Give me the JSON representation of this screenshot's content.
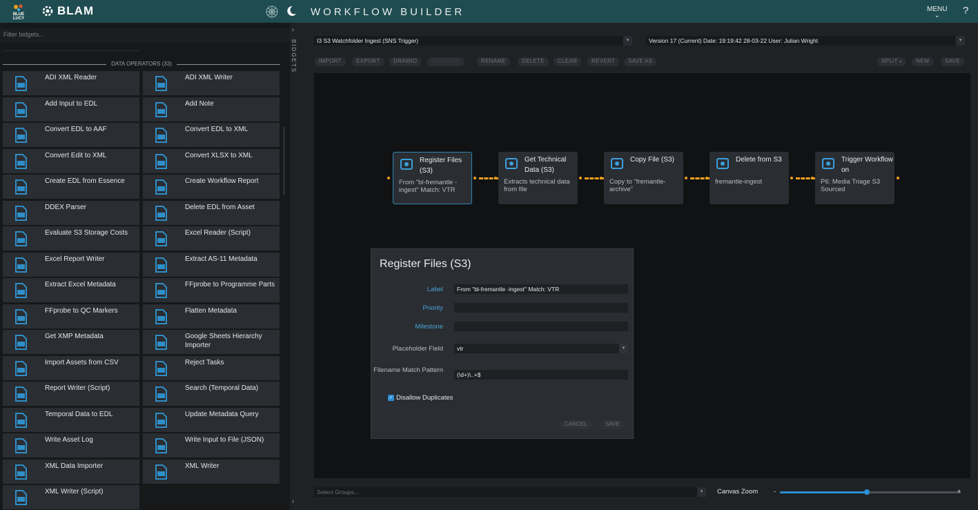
{
  "app": {
    "brand_text": "BLUE LUCY",
    "name": "BLAM",
    "title": "WORKFLOW BUILDER",
    "menu_label": "MENU",
    "help_label": "?",
    "accent_color": "#1f4c50",
    "link_color": "#4aa3d8",
    "connector_color": "#f0a020"
  },
  "sidebar": {
    "filter_placeholder": "Filter bidgets...",
    "section_title": "DATA OPERATORS (33)",
    "tab_label": "BIDGETS",
    "collapse_top_icon": "chevron-right-icon",
    "collapse_bottom_icon": "chevron-left-icon",
    "items": [
      {
        "label": "ADI XML Reader",
        "icon": "xml-file-icon"
      },
      {
        "label": "ADI XML Writer",
        "icon": "xml-file-icon"
      },
      {
        "label": "Add Input to EDL",
        "icon": "edl-add-icon"
      },
      {
        "label": "Add Note",
        "icon": "note-edit-icon"
      },
      {
        "label": "Convert EDL to AAF",
        "icon": "avid-icon"
      },
      {
        "label": "Convert EDL to XML",
        "icon": "edl-xml-icon"
      },
      {
        "label": "Convert Edit to XML",
        "icon": "xml-file-icon"
      },
      {
        "label": "Convert XLSX to XML",
        "icon": "convert-icon"
      },
      {
        "label": "Create EDL from Essence",
        "icon": "edl-download-icon"
      },
      {
        "label": "Create Workflow Report",
        "icon": "excel-icon"
      },
      {
        "label": "DDEX Parser",
        "icon": "ddex-icon"
      },
      {
        "label": "Delete EDL from Asset",
        "icon": "edl-delete-icon"
      },
      {
        "label": "Evaluate S3 Storage Costs",
        "icon": "s3-icon"
      },
      {
        "label": "Excel Reader (Script)",
        "icon": "excel-icon"
      },
      {
        "label": "Excel Report Writer",
        "icon": "pie-chart-icon"
      },
      {
        "label": "Extract AS-11 Metadata",
        "icon": "as11-icon"
      },
      {
        "label": "Extract Excel Metadata",
        "icon": "excel-icon"
      },
      {
        "label": "FFprobe to Programme Parts",
        "icon": "check-circle-icon"
      },
      {
        "label": "FFprobe to QC Markers",
        "icon": "check-circle-icon"
      },
      {
        "label": "Flatten Metadata",
        "icon": "layers-icon"
      },
      {
        "label": "Get XMP Metadata",
        "icon": "file-download-icon"
      },
      {
        "label": "Google Sheets Hierarchy Importer",
        "icon": "google-icon"
      },
      {
        "label": "Import Assets from CSV",
        "icon": "import-icon"
      },
      {
        "label": "Reject Tasks",
        "icon": "bell-icon"
      },
      {
        "label": "Report Writer (Script)",
        "icon": "pie-chart-icon"
      },
      {
        "label": "Search (Temporal Data)",
        "icon": "search-data-icon"
      },
      {
        "label": "Temporal Data to EDL",
        "icon": "edl-icon"
      },
      {
        "label": "Update Metadata Query",
        "icon": "code-icon"
      },
      {
        "label": "Write Asset Log",
        "icon": "pie-chart-icon"
      },
      {
        "label": "Write Input to File (JSON)",
        "icon": "json-file-icon"
      },
      {
        "label": "XML Data Importer",
        "icon": "xml-import-icon"
      },
      {
        "label": "XML Writer",
        "icon": "xml-file-icon"
      },
      {
        "label": "XML Writer (Script)",
        "icon": "xml-edit-icon"
      }
    ]
  },
  "workflow": {
    "selected_workflow": "I3 S3 Watchfolder Ingest (SNS Trigger)",
    "selected_version": "Version 17 (Current) Date: 19:19:42 28-03-22 User: Julian Wright",
    "toolbar": {
      "import": "IMPORT",
      "export": "EXPORT",
      "drawio": "DRAWIO",
      "compare": "COMPARE",
      "rename": "RENAME",
      "delete": "DELETE",
      "clear": "CLEAR",
      "revert": "REVERT",
      "save_as": "SAVE AS",
      "split": "SPLIT",
      "new": "NEW",
      "save": "SAVE"
    },
    "nodes": [
      {
        "title": "Register Files (S3)",
        "desc": "From \"bl-fremantle -ingest\" Match: VTR",
        "icon": "register-files-icon",
        "active": true
      },
      {
        "title": "Get Technical Data (S3)",
        "desc": "Extracts technical data from file",
        "icon": "technical-data-icon",
        "active": false
      },
      {
        "title": "Copy File (S3)",
        "desc": "Copy to \"fremantle-archive\"",
        "icon": "copy-file-icon",
        "active": false
      },
      {
        "title": "Delete from S3",
        "desc": "fremantle-ingest",
        "icon": "delete-s3-icon",
        "active": false
      },
      {
        "title": "Trigger Workflow on",
        "desc": "P6: Media Triage S3 Sourced",
        "icon": "trigger-workflow-icon",
        "active": false
      }
    ]
  },
  "dialog": {
    "title": "Register Files (S3)",
    "label_label": "Label",
    "label_value": "From \"bl-fremantle -ingest\" Match: VTR",
    "priority_label": "Priority",
    "priority_value": "",
    "milestone_label": "Milestone",
    "milestone_value": "",
    "placeholder_label": "Placeholder Field",
    "placeholder_value": "vtr",
    "filename_label": "Filename Match Pattern",
    "filename_value": "(\\d+)\\..+$",
    "disallow_label": "Disallow Duplicates",
    "disallow_checked": true,
    "cancel": "CANCEL",
    "save": "SAVE"
  },
  "bottom": {
    "groups_placeholder": "Select Groups...",
    "zoom_label": "Canvas Zoom",
    "zoom_minus": "-",
    "zoom_plus": "+",
    "zoom_level": 0.48
  }
}
